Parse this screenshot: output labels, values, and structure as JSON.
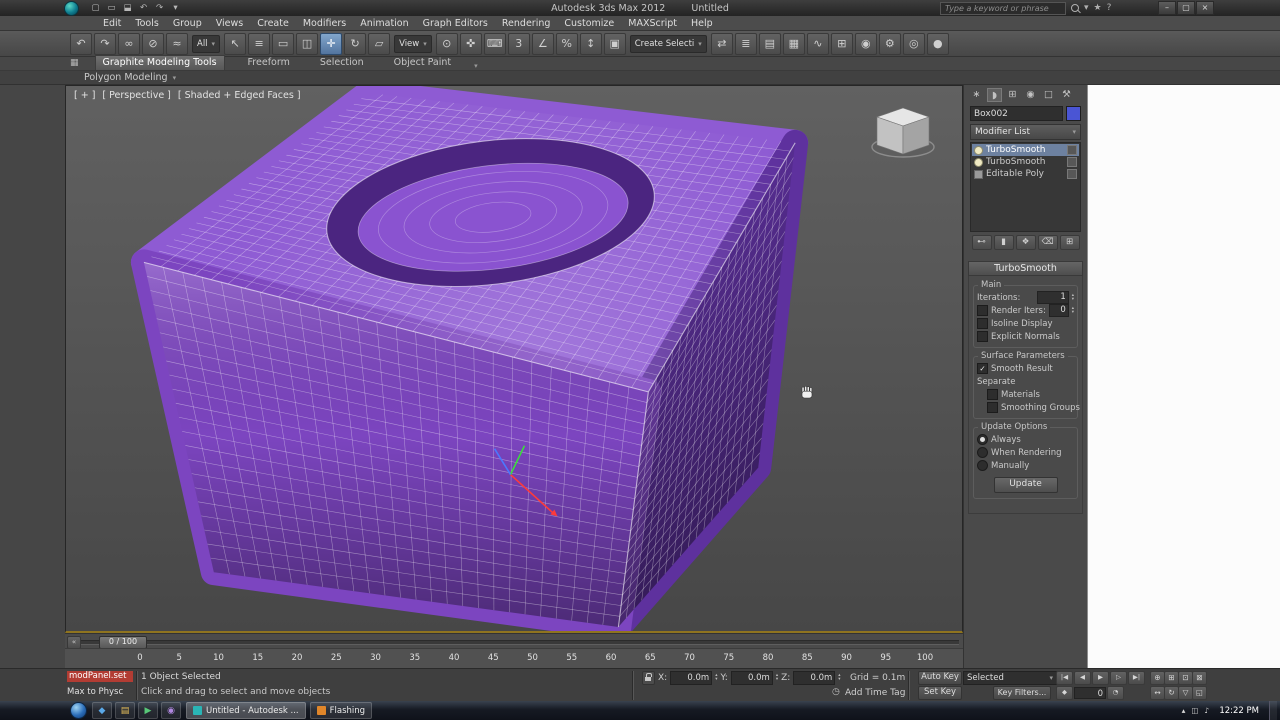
{
  "window": {
    "app_title": "Autodesk 3ds Max 2012",
    "doc_title": "Untitled",
    "minimize_glyph": "–",
    "maximize_glyph": "▢",
    "close_glyph": "×"
  },
  "quick_access": [
    {
      "name": "new-scene-icon",
      "glyph": "▢"
    },
    {
      "name": "open-file-icon",
      "glyph": "▭"
    },
    {
      "name": "save-file-icon",
      "glyph": "⬓"
    },
    {
      "name": "undo-small-icon",
      "glyph": "↶"
    },
    {
      "name": "redo-small-icon",
      "glyph": "↷"
    },
    {
      "name": "project-dropdown-icon",
      "glyph": "▾"
    }
  ],
  "infocenter": {
    "search_placeholder": "Type a keyword or phrase",
    "icons": [
      {
        "name": "search-icon",
        "css": "mag",
        "glyph": ""
      },
      {
        "name": "communication-center-icon",
        "glyph": "▾"
      },
      {
        "name": "favorites-star-icon",
        "glyph": "★"
      },
      {
        "name": "help-icon",
        "glyph": "?"
      }
    ]
  },
  "menubar": [
    "Edit",
    "Tools",
    "Group",
    "Views",
    "Create",
    "Modifiers",
    "Animation",
    "Graph Editors",
    "Rendering",
    "Customize",
    "MAXScript",
    "Help"
  ],
  "toolbar": [
    {
      "name": "undo-button",
      "glyph": "↶"
    },
    {
      "name": "redo-button",
      "glyph": "↷"
    },
    {
      "name": "select-and-link-button",
      "glyph": "∞"
    },
    {
      "name": "unlink-selection-button",
      "glyph": "⊘"
    },
    {
      "name": "bind-to-space-warp-button",
      "glyph": "≈"
    },
    {
      "name": "selection-filter-dropdown",
      "type": "dropdown",
      "label": "All"
    },
    {
      "name": "select-object-button",
      "glyph": "↖"
    },
    {
      "name": "select-by-name-button",
      "glyph": "≡"
    },
    {
      "name": "selection-region-button",
      "glyph": "▭"
    },
    {
      "name": "window-crossing-button",
      "glyph": "◫"
    },
    {
      "name": "select-and-move-button",
      "glyph": "✛",
      "active": true
    },
    {
      "name": "select-and-rotate-button",
      "glyph": "↻"
    },
    {
      "name": "select-and-scale-button",
      "glyph": "▱"
    },
    {
      "name": "reference-coordinate-dropdown",
      "type": "dropdown",
      "label": "View"
    },
    {
      "name": "use-pivot-center-button",
      "glyph": "⊙"
    },
    {
      "name": "select-and-manipulate-button",
      "glyph": "✜"
    },
    {
      "name": "keyboard-override-button",
      "glyph": "⌨"
    },
    {
      "name": "snaps-toggle-button",
      "glyph": "3"
    },
    {
      "name": "angle-snap-button",
      "glyph": "∠"
    },
    {
      "name": "percent-snap-button",
      "glyph": "%"
    },
    {
      "name": "spinner-snap-button",
      "glyph": "↕"
    },
    {
      "name": "edit-named-selections-button",
      "glyph": "▣"
    },
    {
      "name": "named-selection-dropdown",
      "type": "dropdown",
      "label": "Create Selecti"
    },
    {
      "name": "mirror-button",
      "glyph": "⇄"
    },
    {
      "name": "align-button",
      "glyph": "≣"
    },
    {
      "name": "layer-manager-button",
      "glyph": "▤"
    },
    {
      "name": "graphite-toggle-button",
      "glyph": "▦"
    },
    {
      "name": "curve-editor-button",
      "glyph": "∿"
    },
    {
      "name": "schematic-view-button",
      "glyph": "⊞"
    },
    {
      "name": "material-editor-button",
      "glyph": "◉"
    },
    {
      "name": "render-setup-button",
      "glyph": "⚙"
    },
    {
      "name": "rendered-frame-button",
      "glyph": "◎"
    },
    {
      "name": "render-button",
      "glyph": "●"
    }
  ],
  "ribbon": {
    "config_icon_glyph": "▦",
    "tabs": [
      {
        "label": "Graphite Modeling Tools",
        "active": true
      },
      {
        "label": "Freeform",
        "active": false
      },
      {
        "label": "Selection",
        "active": false
      },
      {
        "label": "Object Paint",
        "active": false
      }
    ],
    "tabs_extra_glyph": "▾",
    "strip_label": "Polygon Modeling",
    "strip_arrow_glyph": "▾"
  },
  "viewport": {
    "labels": [
      {
        "name": "viewport-general-menu",
        "text": "[ + ]"
      },
      {
        "name": "viewport-pov-menu",
        "text": "[ Perspective ]"
      },
      {
        "name": "viewport-shading-menu",
        "text": "[ Shaded + Edged Faces ]"
      }
    ]
  },
  "command_panel": {
    "tabs": [
      {
        "name": "create-tab",
        "glyph": "∗",
        "active": false
      },
      {
        "name": "modify-tab",
        "glyph": "◗",
        "active": true
      },
      {
        "name": "hierarchy-tab",
        "glyph": "⊞",
        "active": false
      },
      {
        "name": "motion-tab",
        "glyph": "◉",
        "active": false
      },
      {
        "name": "display-tab",
        "glyph": "□",
        "active": false
      },
      {
        "name": "utilities-tab",
        "glyph": "⚒",
        "active": false
      }
    ],
    "object_name": "Box002",
    "modifier_list_label": "Modifier List",
    "stack": [
      {
        "label": "TurboSmooth",
        "selected": true,
        "icon": "bulb"
      },
      {
        "label": "TurboSmooth",
        "selected": false,
        "icon": "bulb"
      },
      {
        "label": "Editable Poly",
        "selected": false,
        "icon": "poly"
      }
    ],
    "stack_buttons": [
      {
        "name": "pin-stack-button",
        "glyph": "⊷"
      },
      {
        "name": "show-end-result-button",
        "glyph": "▮"
      },
      {
        "name": "make-unique-button",
        "glyph": "❖"
      },
      {
        "name": "remove-modifier-button",
        "glyph": "⌫"
      },
      {
        "name": "configure-modifier-sets-button",
        "glyph": "⊞"
      }
    ],
    "rollout_title": "TurboSmooth",
    "rollout_rows": [
      {
        "type": "group",
        "label": "Main",
        "rows": [
          {
            "type": "spinner",
            "name": "iterations",
            "label": "Iterations:",
            "value": "1"
          },
          {
            "type": "spinner",
            "name": "render-iters",
            "label": "Render Iters:",
            "value": "0",
            "checkbox": true,
            "checked": false
          },
          {
            "type": "check",
            "name": "isoline-display",
            "label": "Isoline Display",
            "checked": false
          },
          {
            "type": "check",
            "name": "explicit-normals",
            "label": "Explicit Normals",
            "checked": false
          }
        ]
      },
      {
        "type": "group",
        "label": "Surface Parameters",
        "rows": [
          {
            "type": "check",
            "name": "smooth-result",
            "label": "Smooth Result",
            "checked": true
          },
          {
            "type": "label",
            "name": "separate-label",
            "label": "Separate"
          },
          {
            "type": "check",
            "name": "materials",
            "label": "Materials",
            "checked": false,
            "indent": true
          },
          {
            "type": "check",
            "name": "smoothing-groups",
            "label": "Smoothing Groups",
            "checked": false,
            "indent": true
          }
        ]
      },
      {
        "type": "group",
        "label": "Update Options",
        "rows": [
          {
            "type": "radio",
            "name": "update-always",
            "label": "Always",
            "selected": true
          },
          {
            "type": "radio",
            "name": "update-when-rendering",
            "label": "When Rendering",
            "selected": false
          },
          {
            "type": "radio",
            "name": "update-manually",
            "label": "Manually",
            "selected": false
          },
          {
            "type": "button",
            "name": "update-button",
            "label": "Update"
          }
        ]
      }
    ]
  },
  "timeline": {
    "left_button_glyph": "«",
    "slider_label": "0 / 100",
    "ticks": [
      0,
      5,
      10,
      15,
      20,
      25,
      30,
      35,
      40,
      45,
      50,
      55,
      60,
      65,
      70,
      75,
      80,
      85,
      90,
      95,
      100
    ]
  },
  "status_bar": {
    "listener_line": "modPanel.set",
    "listener_line2": "Max to Physc",
    "selection_status": "1 Object Selected",
    "prompt": "Click and drag to select and move objects",
    "axis_fields": [
      {
        "label": "X:",
        "value": "0.0m"
      },
      {
        "label": "Y:",
        "value": "0.0m"
      },
      {
        "label": "Z:",
        "value": "0.0m"
      }
    ],
    "grid_text": "Grid = 0.1m",
    "clock_icon_glyph": "◷",
    "time_tag_text": "Add Time Tag",
    "auto_key_label": "Auto Key",
    "set_key_label": "Set Key",
    "selected_dropdown": "Selected",
    "key_filters_label": "Key Filters..."
  },
  "playback": {
    "transport": [
      {
        "name": "go-to-start-button",
        "glyph": "|◀"
      },
      {
        "name": "previous-frame-button",
        "glyph": "◀"
      },
      {
        "name": "play-button",
        "glyph": "▶"
      },
      {
        "name": "next-frame-button",
        "glyph": "▷"
      },
      {
        "name": "go-to-end-button",
        "glyph": "▶|"
      }
    ],
    "key_mode_glyph": "◆",
    "frame_value": "0",
    "time_config_glyph": "◔"
  },
  "nav_buttons": [
    {
      "name": "zoom-button",
      "glyph": "⊕"
    },
    {
      "name": "zoom-all-button",
      "glyph": "⊞"
    },
    {
      "name": "zoom-extents-button",
      "glyph": "⊡"
    },
    {
      "name": "zoom-region-button",
      "glyph": "⊠"
    },
    {
      "name": "pan-button",
      "glyph": "↔"
    },
    {
      "name": "orbit-button",
      "glyph": "↻"
    },
    {
      "name": "fov-button",
      "glyph": "▽"
    },
    {
      "name": "maximize-viewport-button",
      "glyph": "◱"
    }
  ],
  "taskbar": {
    "apps": [
      {
        "name": "taskbar-app-1",
        "glyph": "◆",
        "color": "#5aa8e8"
      },
      {
        "name": "taskbar-app-2",
        "glyph": "▤",
        "color": "#e8c05a"
      },
      {
        "name": "taskbar-app-3",
        "glyph": "▶",
        "color": "#58c878"
      },
      {
        "name": "taskbar-app-4",
        "glyph": "◉",
        "color": "#b088e0"
      }
    ],
    "buttons": [
      {
        "label": "Untitled - Autodesk ...",
        "active": true,
        "icon_color": "#2ab5b5"
      },
      {
        "label": "Flashing",
        "active": false,
        "icon_color": "#e0862a"
      }
    ],
    "tray": [
      "▴",
      "◫",
      "♪"
    ],
    "clock": "12:22 PM"
  }
}
